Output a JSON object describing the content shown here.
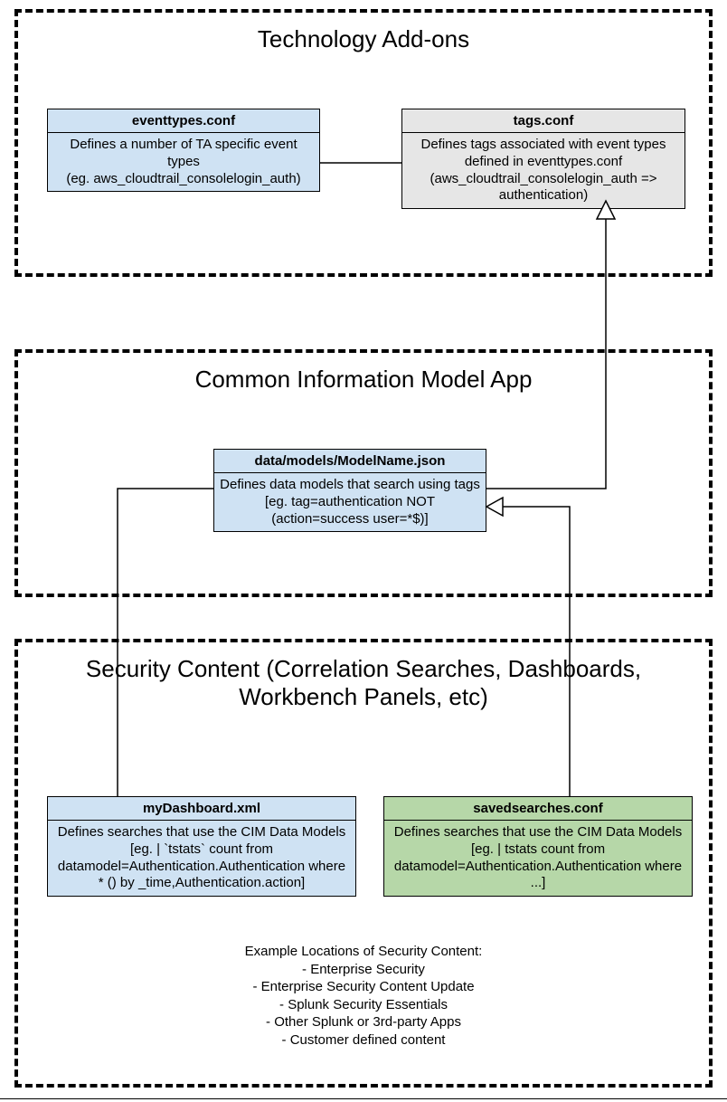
{
  "section1": {
    "title": "Technology Add-ons",
    "box1": {
      "header": "eventtypes.conf",
      "body": "Defines a number of TA specific event types\n(eg. aws_cloudtrail_consolelogin_auth)"
    },
    "box2": {
      "header": "tags.conf",
      "body": "Defines tags associated with event types defined in eventtypes.conf (aws_cloudtrail_consolelogin_auth => authentication)"
    }
  },
  "section2": {
    "title": "Common Information Model App",
    "box1": {
      "header": "data/models/ModelName.json",
      "body": "Defines data models that search using tags [eg. tag=authentication NOT (action=success user=*$)]"
    }
  },
  "section3": {
    "title": "Security Content (Correlation Searches, Dashboards, Workbench Panels, etc)",
    "box1": {
      "header": "myDashboard.xml",
      "body": "Defines searches that use the CIM Data Models\n[eg. | `tstats` count from datamodel=Authentication.Authentication where *  () by _time,Authentication.action]"
    },
    "box2": {
      "header": "savedsearches.conf",
      "body": "Defines searches that use the CIM Data Models\n[eg. | tstats count from datamodel=Authentication.Authentication where ...]"
    },
    "note": "Example Locations of Security Content:\n- Enterprise Security\n- Enterprise Security Content Update\n- Splunk Security Essentials\n- Other Splunk or 3rd-party Apps\n- Customer defined content"
  }
}
